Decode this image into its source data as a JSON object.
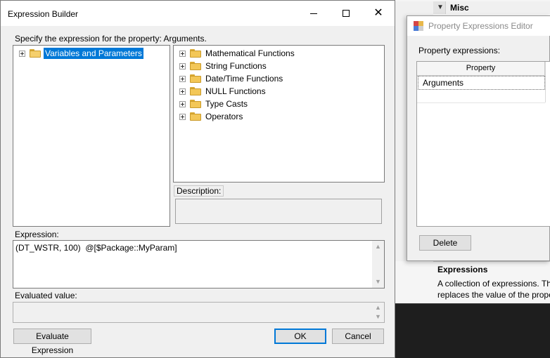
{
  "background_window": {
    "category": "Misc",
    "description": {
      "title": "Expressions",
      "lines": [
        "A collection of expressions. Th",
        "replaces the value of the prope"
      ]
    }
  },
  "property_editor": {
    "title": "Property Expressions Editor",
    "label": "Property expressions:",
    "column_header": "Property",
    "rows": [
      "Arguments"
    ],
    "delete_label": "Delete"
  },
  "expression_builder": {
    "title": "Expression Builder",
    "instruction": "Specify the expression for the property: Arguments.",
    "left_tree": [
      {
        "label": "Variables and Parameters",
        "selected": true
      }
    ],
    "right_tree": [
      {
        "label": "Mathematical Functions"
      },
      {
        "label": "String Functions"
      },
      {
        "label": "Date/Time Functions"
      },
      {
        "label": "NULL Functions"
      },
      {
        "label": "Type Casts"
      },
      {
        "label": "Operators"
      }
    ],
    "description_label": "Description:",
    "expression_label": "Expression:",
    "expression_value": "(DT_WSTR, 100)  @[$Package::MyParam]",
    "evaluated_label": "Evaluated value:",
    "evaluated_value": "",
    "buttons": {
      "evaluate": "Evaluate Expression",
      "ok": "OK",
      "cancel": "Cancel"
    }
  }
}
